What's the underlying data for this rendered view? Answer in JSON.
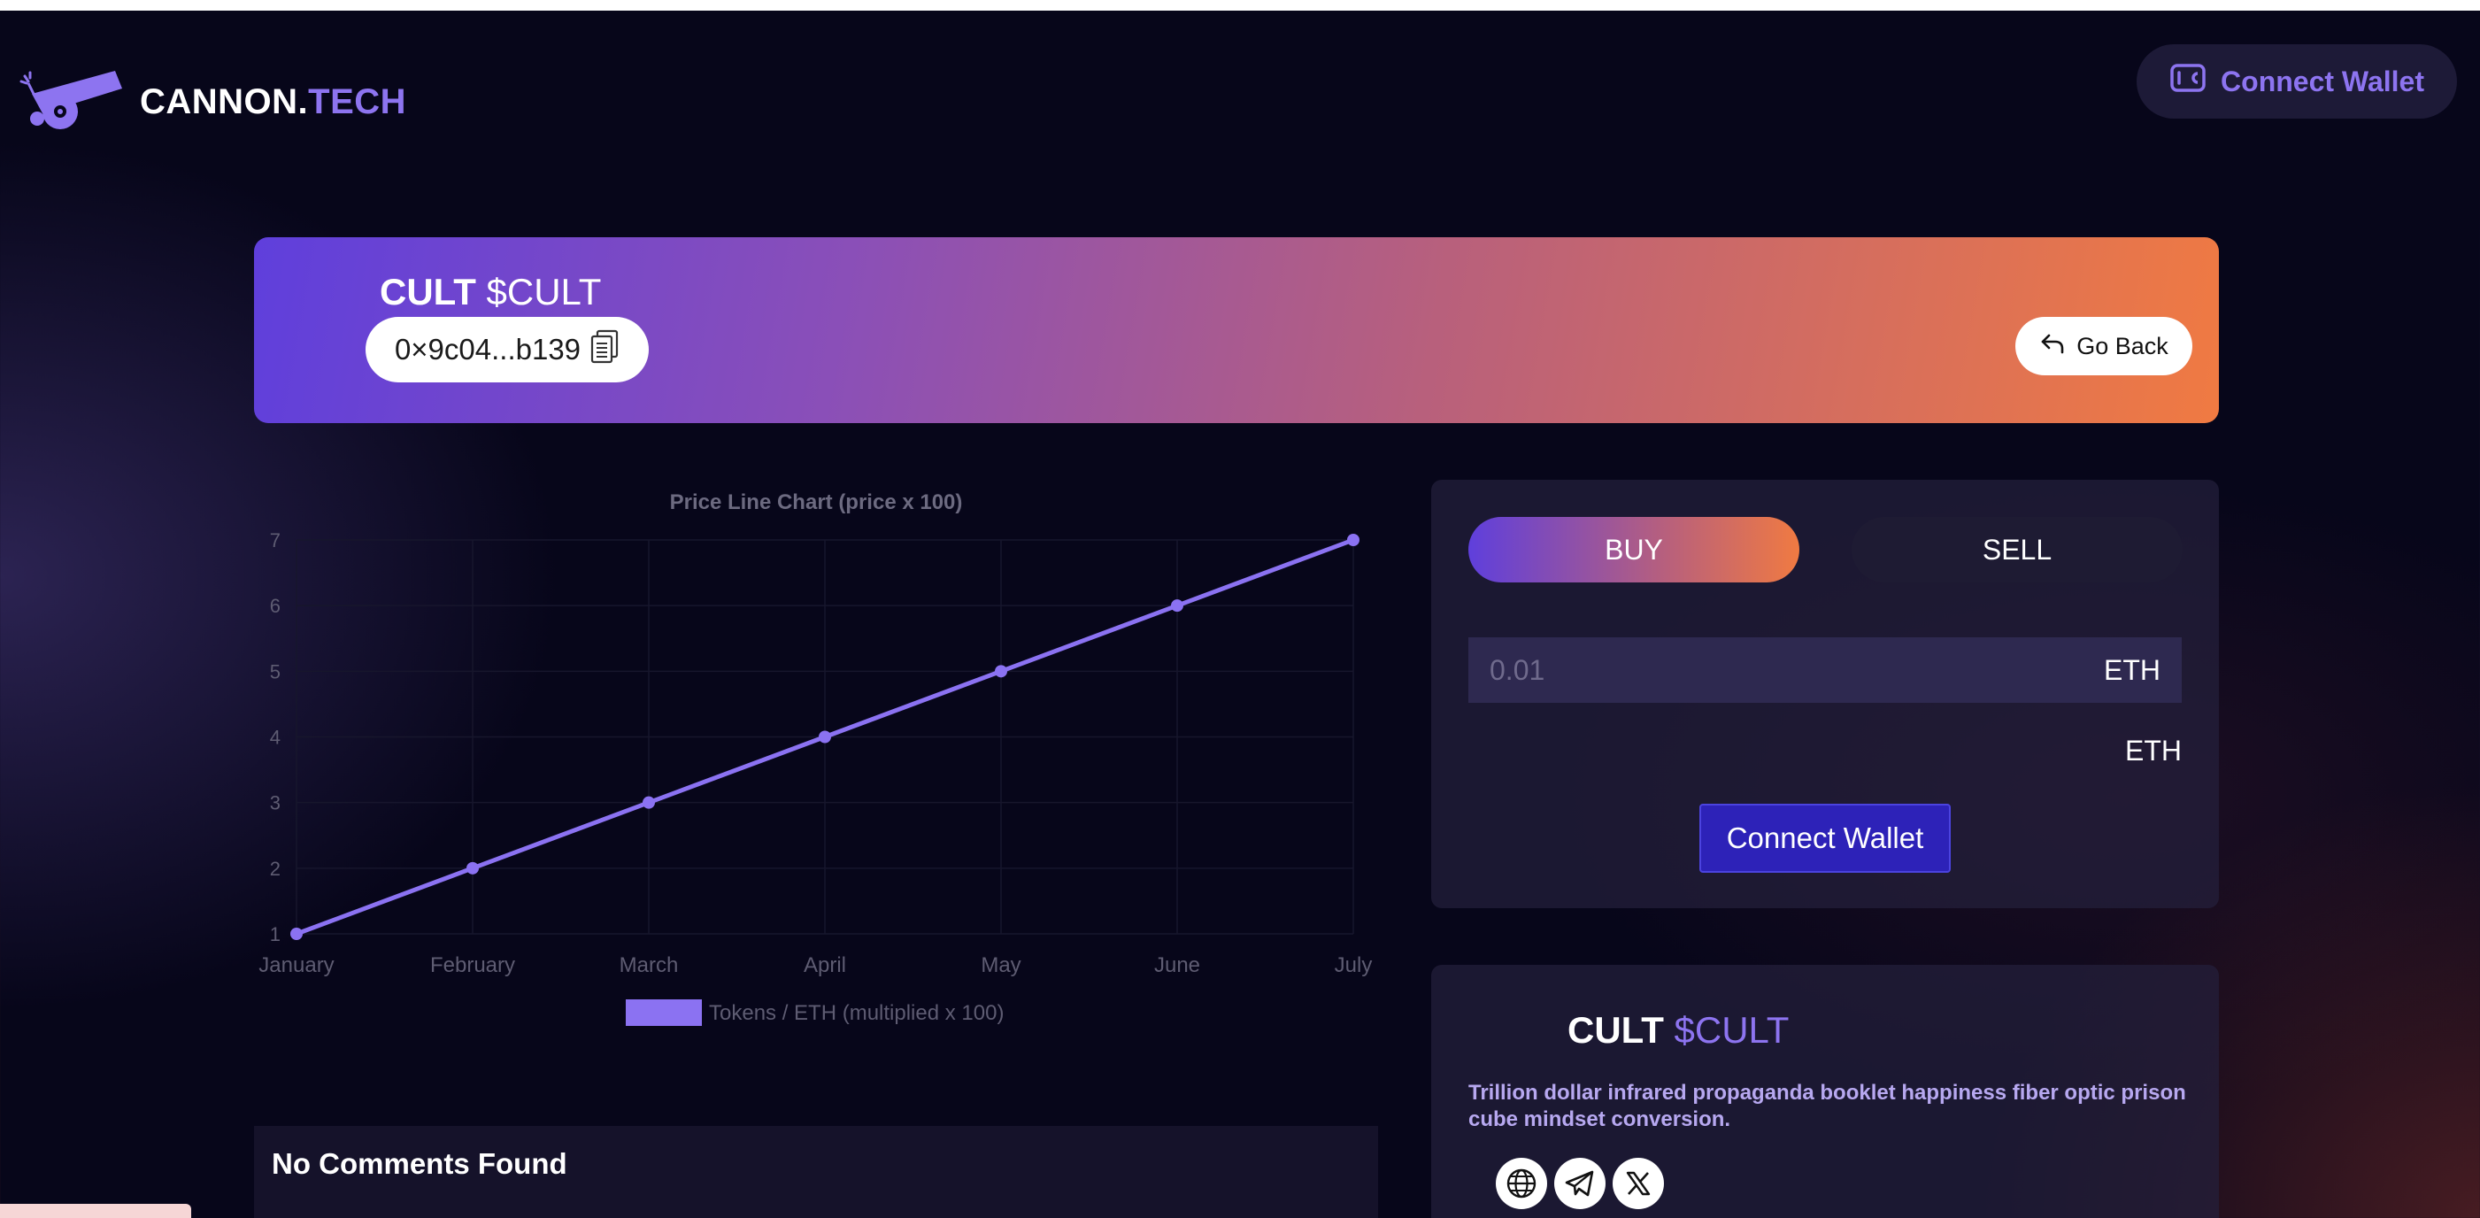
{
  "header": {
    "logo_text_white": "CANNON.",
    "logo_text_purple": "TECH",
    "logo_icon": "cannon-icon",
    "connect_wallet_label": "Connect Wallet",
    "wallet_icon": "wallet-icon"
  },
  "token": {
    "name": "CULT",
    "symbol": "$CULT",
    "address_short": "0×9c04...b139",
    "copy_icon": "copy-icon",
    "go_back_label": "Go Back",
    "go_back_icon": "undo-arrow-icon"
  },
  "trade": {
    "buy_label": "BUY",
    "sell_label": "SELL",
    "amount_placeholder": "0.01",
    "amount_unit": "ETH",
    "receive_unit": "ETH",
    "connect_wallet_label": "Connect Wallet"
  },
  "info": {
    "name": "CULT",
    "symbol": "$CULT",
    "description": "Trillion dollar infrared propaganda booklet happiness fiber optic prison cube mindset conversion.",
    "socials": [
      "globe-icon",
      "telegram-icon",
      "x-icon"
    ]
  },
  "comments": {
    "empty_label": "No Comments Found"
  },
  "colors": {
    "accent": "#8d74f0",
    "line": "#8b72f2",
    "background": "#07061a",
    "gradient_start": "#5f3fdc",
    "gradient_end": "#f07a42"
  },
  "chart_data": {
    "type": "line",
    "title": "Price Line Chart (price x 100)",
    "categories": [
      "January",
      "February",
      "March",
      "April",
      "May",
      "June",
      "July"
    ],
    "series": [
      {
        "name": "Tokens / ETH (multiplied x 100)",
        "values": [
          1,
          2,
          3,
          4,
          5,
          6,
          7
        ]
      }
    ],
    "ylim": [
      1,
      7
    ],
    "yticks": [
      1,
      2,
      3,
      4,
      5,
      6,
      7
    ],
    "legend": "bottom",
    "grid": true
  }
}
